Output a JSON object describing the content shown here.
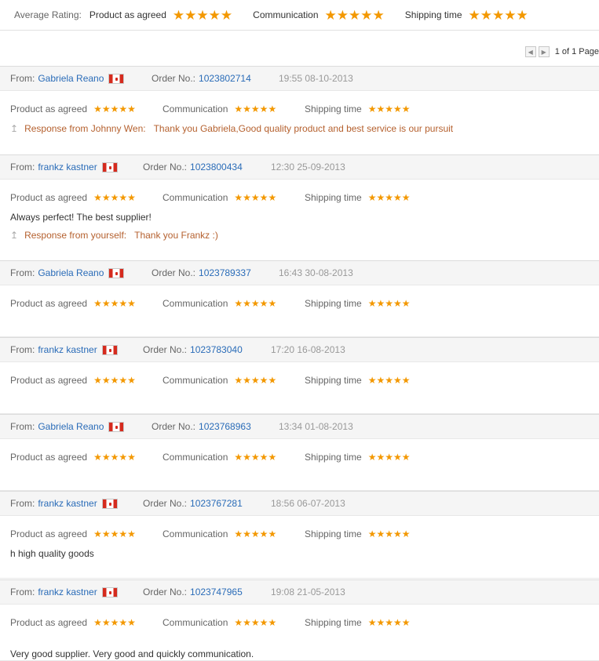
{
  "summary": {
    "label": "Average Rating:",
    "ratings": [
      {
        "label": "Product as agreed",
        "stars": 5
      },
      {
        "label": "Communication",
        "stars": 5
      },
      {
        "label": "Shipping time",
        "stars": 5
      }
    ]
  },
  "pager": {
    "text": "1 of 1 Page"
  },
  "labels": {
    "from": "From:",
    "order": "Order No.:",
    "product": "Product as agreed",
    "communication": "Communication",
    "shipping": "Shipping time"
  },
  "colors": {
    "star": "#f39800",
    "link": "#2a6cb8",
    "response": "#b5612f"
  },
  "reviews": [
    {
      "name": "Gabriela Reano",
      "order": "1023802714",
      "date": "19:55 08-10-2013",
      "stars": [
        5,
        5,
        5
      ],
      "comment": "",
      "response_label": "Response from Johnny Wen:",
      "response": "Thank you Gabriela,Good quality product and best service is our pursuit"
    },
    {
      "name": "frankz kastner",
      "order": "1023800434",
      "date": "12:30 25-09-2013",
      "stars": [
        5,
        5,
        5
      ],
      "comment": "Always perfect! The best supplier!",
      "response_label": "Response from yourself:",
      "response": "Thank you Frankz :)"
    },
    {
      "name": "Gabriela Reano",
      "order": "1023789337",
      "date": "16:43 30-08-2013",
      "stars": [
        5,
        5,
        5
      ],
      "comment": "",
      "response_label": "",
      "response": ""
    },
    {
      "name": "frankz kastner",
      "order": "1023783040",
      "date": "17:20 16-08-2013",
      "stars": [
        5,
        5,
        5
      ],
      "comment": "",
      "response_label": "",
      "response": ""
    },
    {
      "name": "Gabriela Reano",
      "order": "1023768963",
      "date": "13:34 01-08-2013",
      "stars": [
        5,
        5,
        5
      ],
      "comment": "",
      "response_label": "",
      "response": ""
    },
    {
      "name": "frankz kastner",
      "order": "1023767281",
      "date": "18:56 06-07-2013",
      "stars": [
        5,
        5,
        5
      ],
      "comment": "h high quality goods",
      "response_label": "",
      "response": ""
    },
    {
      "name": "frankz kastner",
      "order": "1023747965",
      "date": "19:08 21-05-2013",
      "stars": [
        5,
        5,
        5
      ],
      "comment": "Very good supplier. Very good and quickly communication.",
      "response_label": "",
      "response": ""
    }
  ]
}
